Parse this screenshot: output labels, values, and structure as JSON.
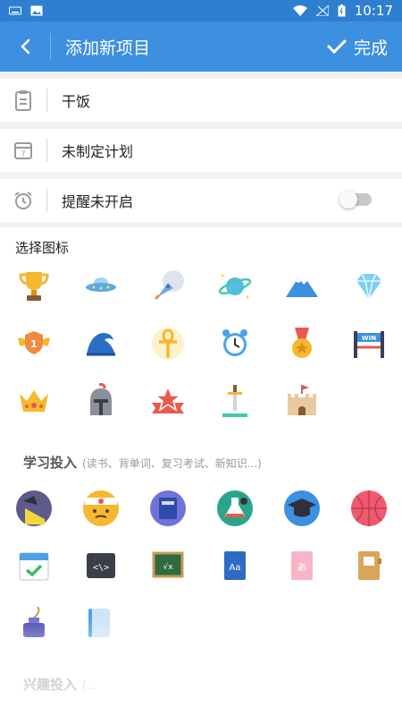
{
  "status_bar": {
    "time": "10:17"
  },
  "app_bar": {
    "title": "添加新项目",
    "done_label": "完成"
  },
  "form": {
    "name_value": "干饭",
    "plan_value": "未制定计划",
    "reminder_value": "提醒未开启",
    "reminder_enabled": false
  },
  "icon_section": {
    "title": "选择图标",
    "study_heading": "学习投入",
    "study_sub": "(读书、背单词、复习考试、新知识...)",
    "interest_heading": "兴趣投入",
    "interest_sub": "(..."
  },
  "icons": {
    "achievement": [
      "trophy-icon",
      "ufo-icon",
      "rocket-icon",
      "planet-icon",
      "mountain-icon",
      "diamond-icon",
      "winged-badge-icon",
      "wave-icon",
      "ankh-icon",
      "alarm-clock-icon",
      "medal-icon",
      "win-banner-icon",
      "crown-icon",
      "helmet-icon",
      "star-ribbon-icon",
      "sword-icon",
      "castle-icon"
    ],
    "study": [
      "desk-lamp-icon",
      "headband-face-icon",
      "book-icon",
      "flask-icon",
      "graduation-cap-icon",
      "basketball-icon",
      "calendar-check-icon",
      "code-window-icon",
      "chalkboard-icon",
      "dictionary-icon",
      "japanese-card-icon",
      "notebook-icon",
      "ink-bottle-icon",
      "tablet-icon"
    ]
  },
  "colors": {
    "status_bar": "#2f7fd0",
    "app_bar": "#3d8fe0",
    "background": "#f2f2f2"
  }
}
